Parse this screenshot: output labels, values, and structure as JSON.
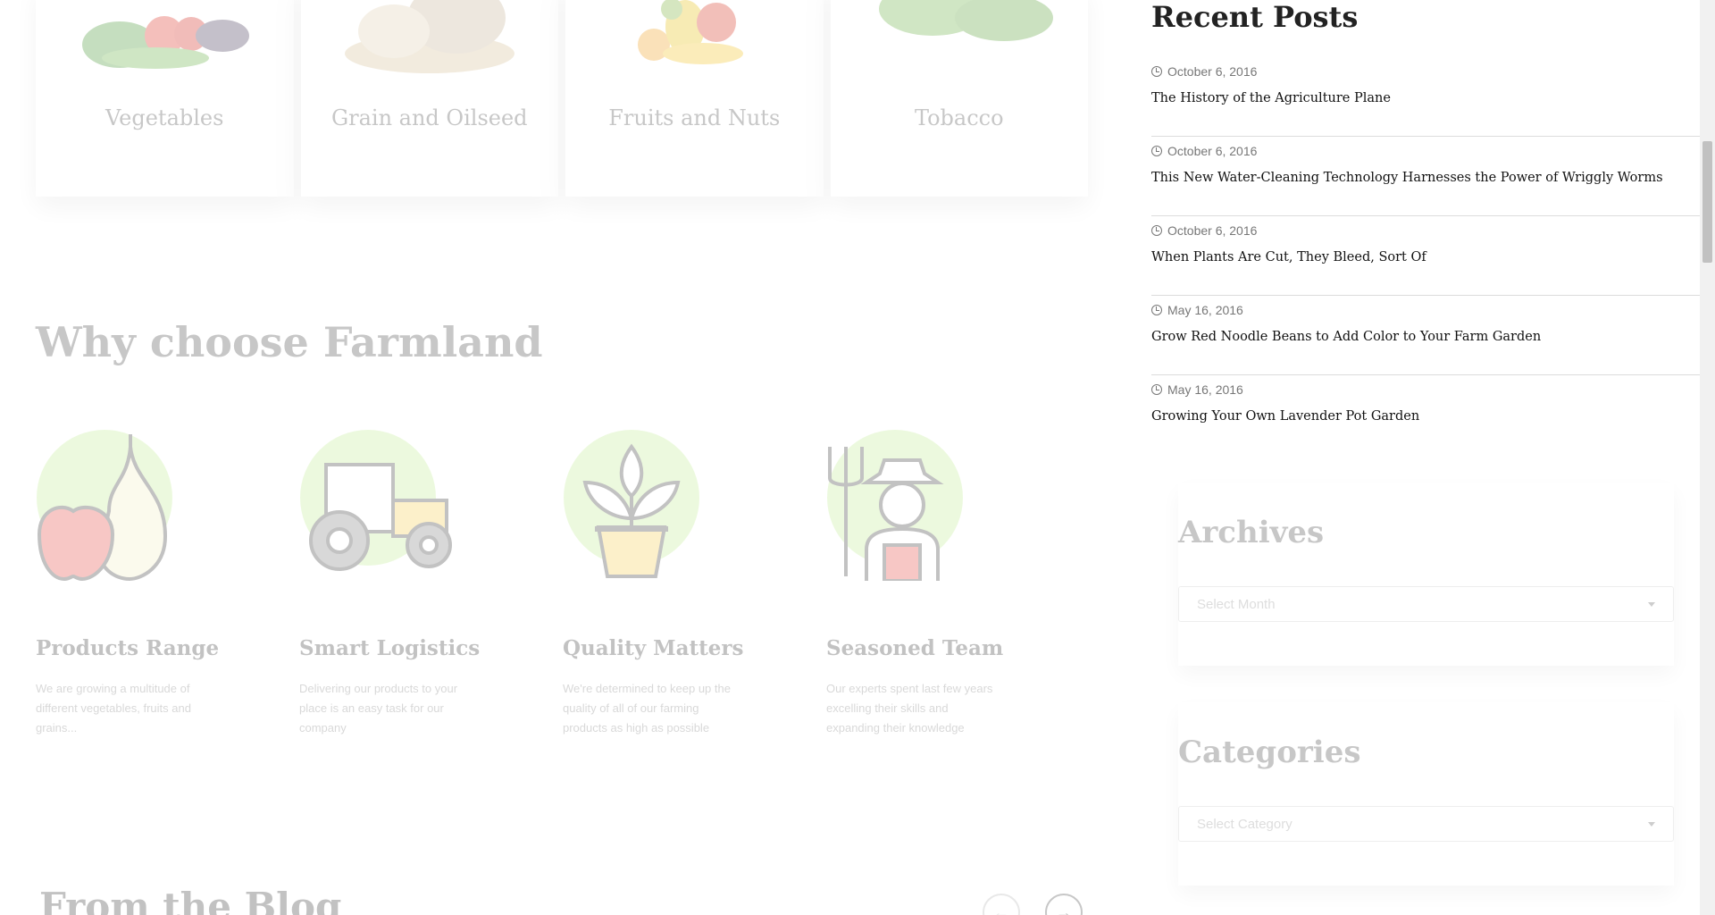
{
  "categories": [
    {
      "title": "Vegetables"
    },
    {
      "title": "Grain and Oilseed"
    },
    {
      "title": "Fruits and Nuts"
    },
    {
      "title": "Tobacco"
    }
  ],
  "why_choose": {
    "title": "Why choose Farmland",
    "features": [
      {
        "title": "Products Range",
        "description": "We are growing a multitude of different vegetables, fruits and grains...",
        "icon": "fruits-icon"
      },
      {
        "title": "Smart Logistics",
        "description": "Delivering our products to your place is an easy task for our company",
        "icon": "tractor-icon"
      },
      {
        "title": "Quality Matters",
        "description": "We're determined to keep up the quality of all of our farming products as high as possible",
        "icon": "plant-pot-icon"
      },
      {
        "title": "Seasoned Team",
        "description": "Our experts spent last few years excelling their skills and expanding their knowledge",
        "icon": "farmer-icon"
      }
    ]
  },
  "blog": {
    "title": "From the Blog"
  },
  "sidebar": {
    "recent_posts": {
      "title": "Recent Posts",
      "posts": [
        {
          "date": "October 6, 2016",
          "title": "The History of the Agriculture Plane"
        },
        {
          "date": "October 6, 2016",
          "title": "This New Water-Cleaning Technology Harnesses the Power of Wriggly Worms"
        },
        {
          "date": "October 6, 2016",
          "title": "When Plants Are Cut, They Bleed, Sort Of"
        },
        {
          "date": "May 16, 2016",
          "title": "Grow Red Noodle Beans to Add Color to Your Farm Garden"
        },
        {
          "date": "May 16, 2016",
          "title": "Growing Your Own Lavender Pot Garden"
        }
      ]
    },
    "archives": {
      "title": "Archives",
      "select_placeholder": "Select Month"
    },
    "categories": {
      "title": "Categories",
      "select_placeholder": "Select Category"
    }
  },
  "colors": {
    "accent_green": "#c6ef9a",
    "icon_red": "#e8534f",
    "icon_yellow": "#f6d35c"
  }
}
